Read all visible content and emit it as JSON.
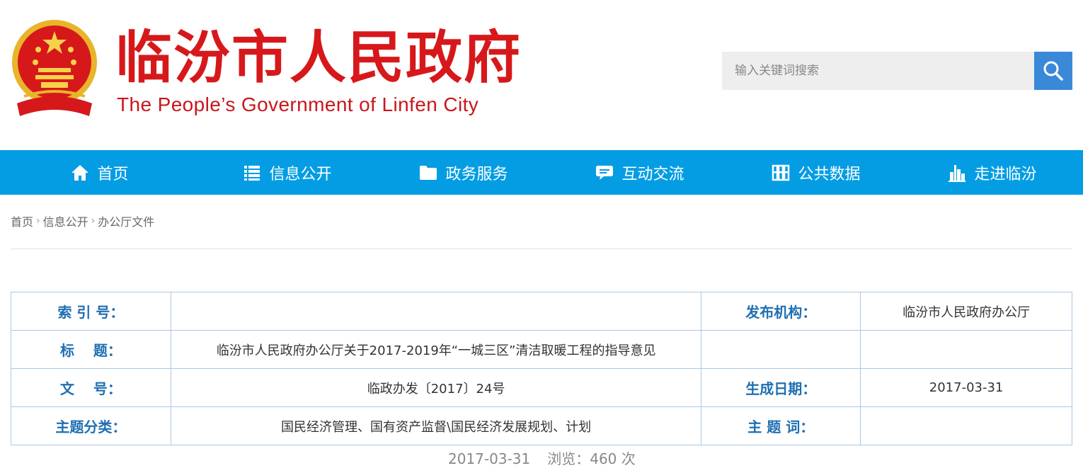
{
  "header": {
    "title": "临汾市人民政府",
    "subtitle": "The People’s Government of Linfen City",
    "search_placeholder": "输入关键词搜索",
    "colors": {
      "title_red": "#d7181b",
      "search_blue": "#3a89d8"
    }
  },
  "nav": {
    "color": "#049de4",
    "items": [
      {
        "label": "首页",
        "icon": "home-icon"
      },
      {
        "label": "信息公开",
        "icon": "list-icon"
      },
      {
        "label": "政务服务",
        "icon": "folder-icon"
      },
      {
        "label": "互动交流",
        "icon": "chat-icon"
      },
      {
        "label": "公共数据",
        "icon": "grid-icon"
      },
      {
        "label": "走进临汾",
        "icon": "city-icon"
      }
    ]
  },
  "breadcrumb": [
    "首页",
    "信息公开",
    "办公厅文件"
  ],
  "info": {
    "index_label": "索 引 号：",
    "index_value": "",
    "publisher_label": "发布机构：",
    "publisher_value": "临汾市人民政府办公厅",
    "title_label": "标　 题：",
    "title_value": "临汾市人民政府办公厅关于2017-2019年“一城三区”清洁取暖工程的指导意见",
    "docno_label": "文　 号：",
    "docno_value": "临政办发〔2017〕24号",
    "date_label": "生成日期：",
    "date_value": "2017-03-31",
    "topic_label": "主题分类：",
    "topic_value": "国民经济管理、国有资产监督\\国民经济发展规划、计划",
    "keyword_label": "主 题 词：",
    "keyword_value": ""
  },
  "meta": {
    "date": "2017-03-31",
    "views": "浏览：460 次"
  }
}
